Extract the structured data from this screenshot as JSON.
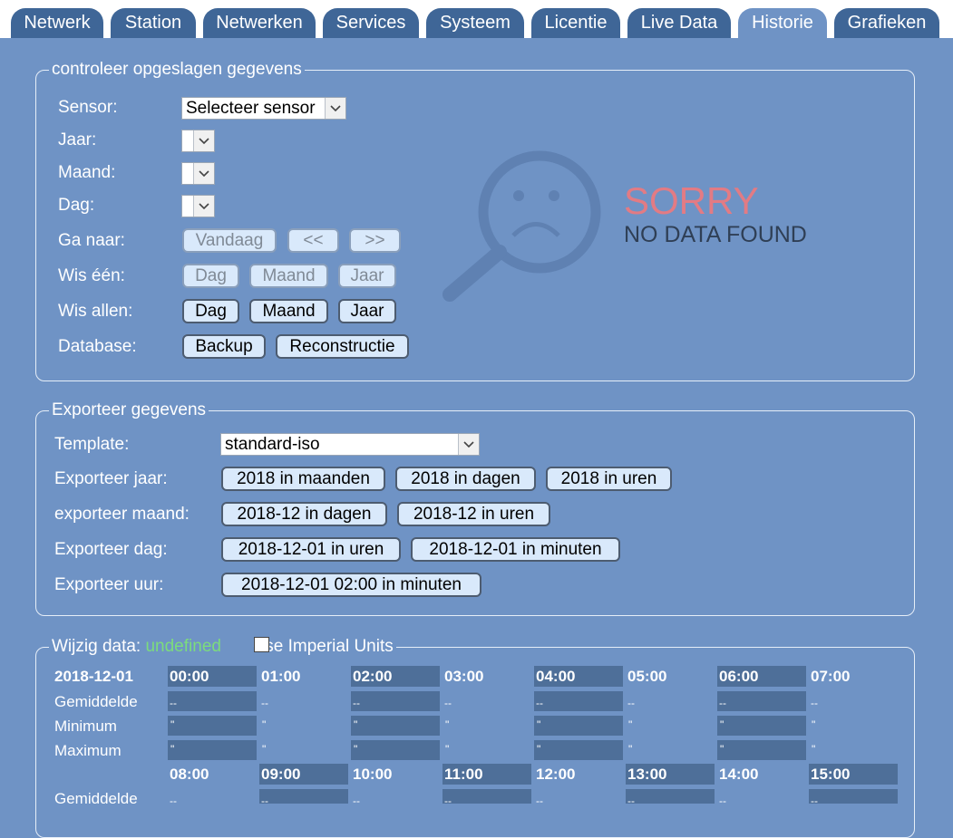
{
  "tabs": [
    "Netwerk",
    "Station",
    "Netwerken",
    "Services",
    "Systeem",
    "Licentie",
    "Live Data",
    "Historie",
    "Grafieken"
  ],
  "active_tab": "Historie",
  "stored": {
    "legend": "controleer opgeslagen gegevens",
    "sensor_label": "Sensor:",
    "sensor_value": "Selecteer sensor",
    "jaar_label": "Jaar:",
    "maand_label": "Maand:",
    "dag_label": "Dag:",
    "goto_label": "Ga naar:",
    "goto_today": "Vandaag",
    "goto_prev": "<<",
    "goto_next": ">>",
    "clear_one_label": "Wis één:",
    "clear_all_label": "Wis allen:",
    "btn_dag": "Dag",
    "btn_maand": "Maand",
    "btn_jaar": "Jaar",
    "database_label": "Database:",
    "backup": "Backup",
    "rebuild": "Reconstructie",
    "sorry_title": "SORRY",
    "sorry_sub": "NO DATA FOUND"
  },
  "export": {
    "legend": "Exporteer gegevens",
    "template_label": "Template:",
    "template_value": "standard-iso",
    "year_label": "Exporteer jaar:",
    "year_buttons": [
      "2018 in maanden",
      "2018 in dagen",
      "2018 in uren"
    ],
    "month_label": "exporteer maand:",
    "month_buttons": [
      "2018-12 in dagen",
      "2018-12 in uren"
    ],
    "day_label": "Exporteer dag:",
    "day_buttons": [
      "2018-12-01 in uren",
      "2018-12-01 in minuten"
    ],
    "hour_label": "Exporteer uur:",
    "hour_buttons": [
      "2018-12-01 02:00 in minuten"
    ]
  },
  "edit": {
    "legend_label": "Wijzig data:",
    "legend_value": "undefined",
    "imperial_label": "Use Imperial Units",
    "date": "2018-12-01",
    "row_labels": [
      "Gemiddelde",
      "Minimum",
      "Maximum"
    ],
    "hours_row1": [
      "00:00",
      "01:00",
      "02:00",
      "03:00",
      "04:00",
      "05:00",
      "06:00",
      "07:00"
    ],
    "hours_row2": [
      "08:00",
      "09:00",
      "10:00",
      "11:00",
      "12:00",
      "13:00",
      "14:00",
      "15:00"
    ],
    "avg_value": "--",
    "min_value": "\"",
    "max_value": "\""
  },
  "colors": {
    "background": "#6f93c5",
    "tab": "#3f6697",
    "button": "#d9e9fb",
    "sorry": "#e27b84",
    "undefined": "#7cdc7c"
  }
}
